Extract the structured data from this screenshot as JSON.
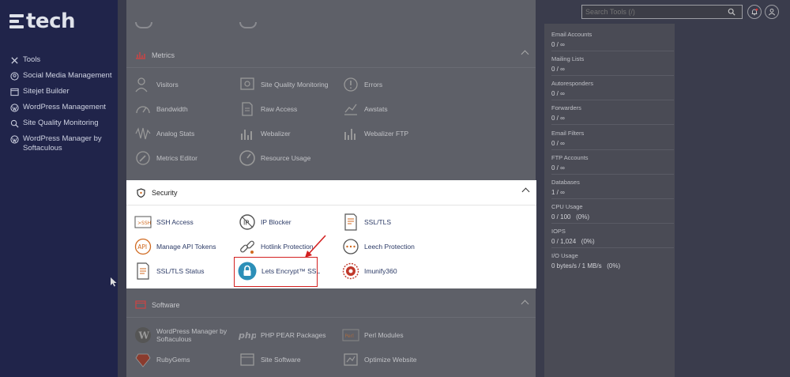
{
  "brand": {
    "name": "tech"
  },
  "sidebar": {
    "items": [
      {
        "label": "Tools",
        "icon": "tools-icon"
      },
      {
        "label": "Social Media Management",
        "icon": "social-icon"
      },
      {
        "label": "Sitejet Builder",
        "icon": "sitejet-icon"
      },
      {
        "label": "WordPress Management",
        "icon": "wordpress-icon"
      },
      {
        "label": "Site Quality Monitoring",
        "icon": "monitor-icon"
      },
      {
        "label": "WordPress Manager by Softaculous",
        "icon": "wordpress-icon"
      }
    ]
  },
  "search": {
    "placeholder": "Search Tools (/)"
  },
  "metrics": {
    "title": "Metrics",
    "tools": [
      {
        "label": "Visitors"
      },
      {
        "label": "Site Quality Monitoring"
      },
      {
        "label": "Errors"
      },
      {
        "label": "Bandwidth"
      },
      {
        "label": "Raw Access"
      },
      {
        "label": "Awstats"
      },
      {
        "label": "Analog Stats"
      },
      {
        "label": "Webalizer"
      },
      {
        "label": "Webalizer FTP"
      },
      {
        "label": "Metrics Editor"
      },
      {
        "label": "Resource Usage"
      }
    ]
  },
  "security": {
    "title": "Security",
    "tools": [
      {
        "label": "SSH Access"
      },
      {
        "label": "IP Blocker"
      },
      {
        "label": "SSL/TLS"
      },
      {
        "label": "Manage API Tokens"
      },
      {
        "label": "Hotlink Protection"
      },
      {
        "label": "Leech Protection"
      },
      {
        "label": "SSL/TLS Status"
      },
      {
        "label": "Lets Encrypt™ SSL"
      },
      {
        "label": "Imunify360"
      }
    ]
  },
  "software": {
    "title": "Software",
    "tools": [
      {
        "label": "WordPress Manager by Softaculous"
      },
      {
        "label": "PHP PEAR Packages"
      },
      {
        "label": "Perl Modules"
      },
      {
        "label": "RubyGems"
      },
      {
        "label": "Site Software"
      },
      {
        "label": "Optimize Website"
      }
    ]
  },
  "stats": [
    {
      "label": "Email Accounts",
      "value": "0 / ∞"
    },
    {
      "label": "Mailing Lists",
      "value": "0 / ∞"
    },
    {
      "label": "Autoresponders",
      "value": "0 / ∞"
    },
    {
      "label": "Forwarders",
      "value": "0 / ∞"
    },
    {
      "label": "Email Filters",
      "value": "0 / ∞"
    },
    {
      "label": "FTP Accounts",
      "value": "0 / ∞"
    },
    {
      "label": "Databases",
      "value": "1 / ∞"
    },
    {
      "label": "CPU Usage",
      "value": "0 / 100   (0%)"
    },
    {
      "label": "IOPS",
      "value": "0 / 1,024   (0%)"
    },
    {
      "label": "I/O Usage",
      "value": "0 bytes/s / 1 MB/s   (0%)"
    }
  ],
  "colors": {
    "sidebar": "#20244a",
    "highlight": "#d32020",
    "accent": "#2b3a66"
  }
}
